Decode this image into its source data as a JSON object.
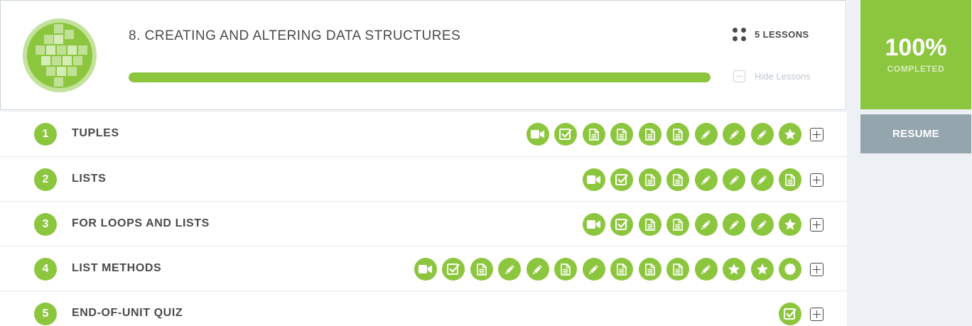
{
  "unit": {
    "title": "8. CREATING AND ALTERING DATA STRUCTURES",
    "lessons_count": "5 LESSONS",
    "hide_lessons": "Hide Lessons",
    "progress": 1.0,
    "badge_icon": "pixel-puzzle-badge-icon"
  },
  "completion": {
    "percent_label": "100%",
    "label": "COMPLETED",
    "resume": "RESUME"
  },
  "colors": {
    "accent": "#8cc63e",
    "resume": "#95a5ae",
    "text": "#4a4a4a"
  },
  "lessons": [
    {
      "number": "1",
      "title": "TUPLES",
      "activities": [
        "video",
        "check",
        "doc",
        "doc",
        "doc",
        "doc",
        "pencil",
        "pencil",
        "pencil",
        "star"
      ]
    },
    {
      "number": "2",
      "title": "LISTS",
      "activities": [
        "video",
        "check",
        "doc",
        "doc",
        "pencil",
        "pencil",
        "pencil",
        "doc"
      ]
    },
    {
      "number": "3",
      "title": "FOR LOOPS AND LISTS",
      "activities": [
        "video",
        "check",
        "doc",
        "doc",
        "pencil",
        "pencil",
        "pencil",
        "star"
      ]
    },
    {
      "number": "4",
      "title": "LIST METHODS",
      "activities": [
        "video",
        "check",
        "doc",
        "pencil",
        "pencil",
        "doc",
        "pencil",
        "doc",
        "doc",
        "doc",
        "pencil",
        "star",
        "star",
        "seal"
      ]
    },
    {
      "number": "5",
      "title": "END-OF-UNIT QUIZ",
      "activities": [
        "check"
      ]
    }
  ]
}
